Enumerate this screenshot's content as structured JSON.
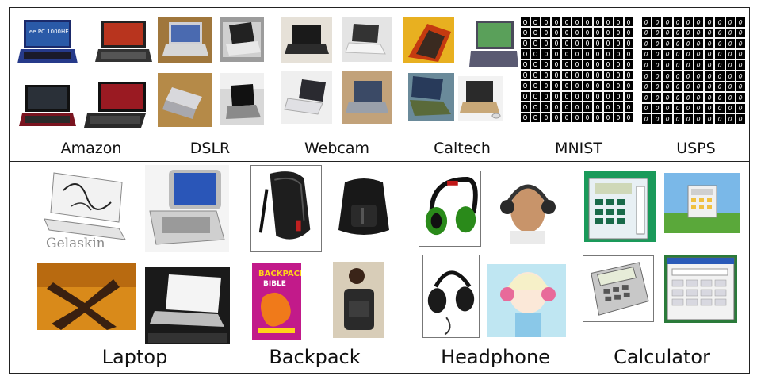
{
  "top_panel": {
    "domains": [
      {
        "label": "Amazon"
      },
      {
        "label": "DSLR"
      },
      {
        "label": "Webcam"
      },
      {
        "label": "Caltech"
      },
      {
        "label": "MNIST"
      },
      {
        "label": "USPS"
      }
    ],
    "amazon_thumb_text": "ee PC 1000HE"
  },
  "bottom_panel": {
    "categories": [
      {
        "label": "Laptop"
      },
      {
        "label": "Backpack"
      },
      {
        "label": "Headphone"
      },
      {
        "label": "Calculator"
      }
    ],
    "laptop_thumb_text": "Gelaskin",
    "backpack_book_text": "BACKPACK",
    "backpack_book_subtext": "BIBLE"
  },
  "colors": {
    "border": "#222222",
    "background": "#ffffff"
  }
}
